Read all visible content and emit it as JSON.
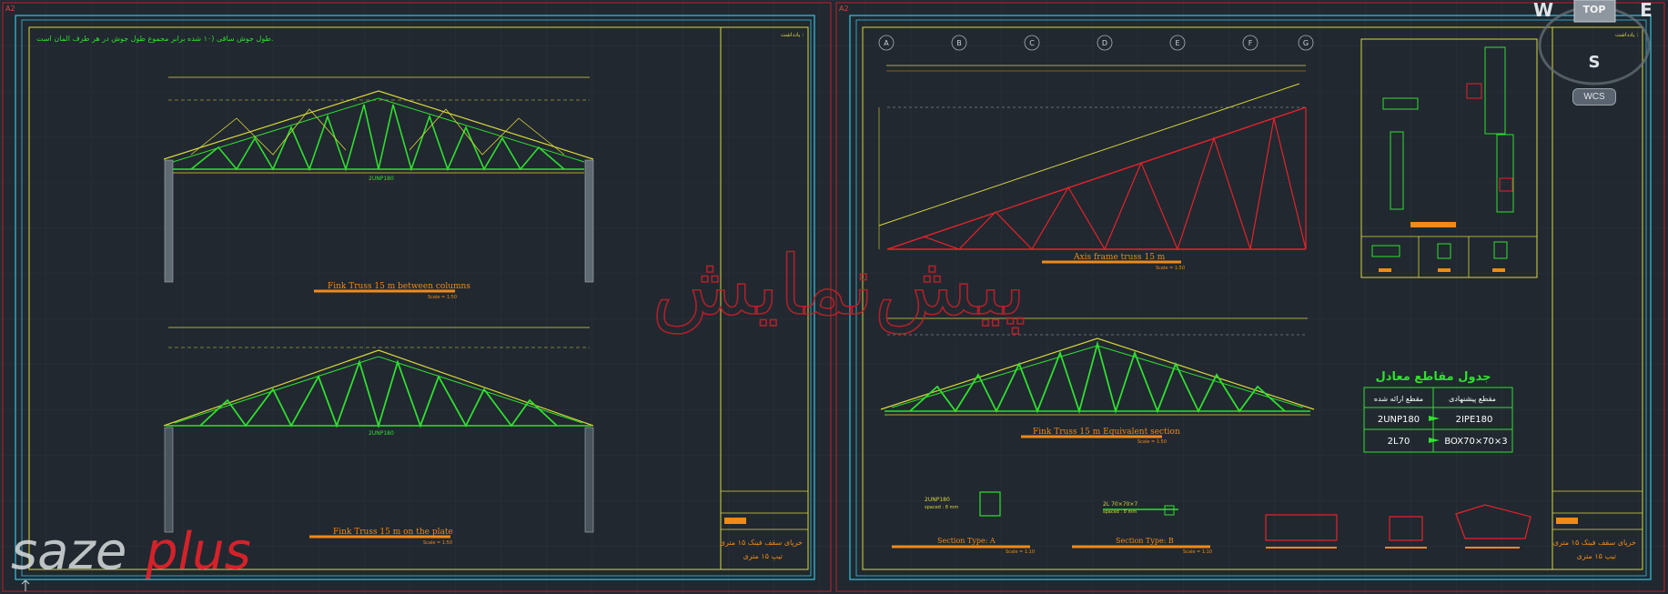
{
  "sheets": [
    {
      "id": "left",
      "label": "A2"
    },
    {
      "id": "right",
      "label": "A2"
    }
  ],
  "notes": {
    "top_left": "طول جوش ساقی (۱۰ شده برابر مجموع طول جوش در هر طرف المان است.",
    "title_block_header": "یادداشت :"
  },
  "drawings": {
    "fink_between_columns": {
      "title": "Fink Truss 15 m between columns",
      "scale": "Scale = 1:50",
      "section": "2UNP180"
    },
    "fink_on_plate": {
      "title": "Fink Truss 15 m  on the plate",
      "scale": "Scale = 1:50",
      "section": "2UNP180"
    },
    "axis_frame": {
      "title": "Axis frame truss 15 m",
      "scale": "Scale = 1:50"
    },
    "fink_equivalent": {
      "title": "Fink Truss 15 m Equivalent section",
      "scale": "Scale = 1:50"
    },
    "section_a": {
      "title": "Section Type: A",
      "label": "2UNP180",
      "sub": "spaced : 8 mm",
      "scale": "Scale = 1:10"
    },
    "section_b": {
      "title": "Section Type: B",
      "label": "2L 70×70×7",
      "sub": "spaced : 8 mm",
      "scale": "Scale = 1:10"
    }
  },
  "grid_axes": [
    "A",
    "B",
    "C",
    "D",
    "E",
    "F",
    "G"
  ],
  "equivalent_table": {
    "title": "جدول مقاطع معادل",
    "header_left": "مقطع ارائه شده",
    "header_right": "مقطع پیشنهادی",
    "rows": [
      {
        "given": "2UNP180",
        "proposed": "2IPE180"
      },
      {
        "given": "2L70",
        "proposed": "BOX70×70×3"
      }
    ]
  },
  "title_block": {
    "name_line1": "خرپای سقف فینک ۱۵ متری",
    "name_line2": "تیپ ۱۵ متری"
  },
  "watermark": "پیش‌نمایش",
  "logo": {
    "part1": "saze",
    "part2": "plus"
  },
  "viewcube": {
    "west": "W",
    "top": "TOP",
    "east": "E",
    "south": "S",
    "wcs": "WCS"
  },
  "colors": {
    "background": "#212830",
    "frame_red": "#c0202a",
    "border_cyan": "#35c5e0",
    "title_yellow": "#d8d83a",
    "truss_green": "#2fe02f",
    "truss_red": "#e8222a",
    "dim_orange": "#f08a18",
    "grid_white": "#cfd3d6"
  }
}
